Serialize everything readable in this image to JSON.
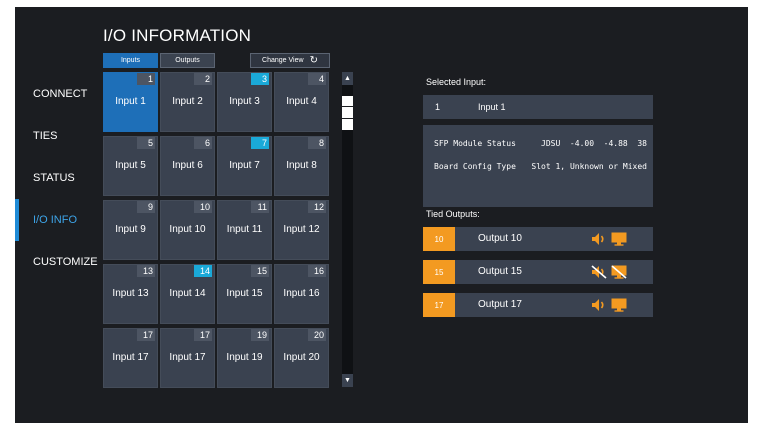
{
  "page": {
    "title": "I/O INFORMATION"
  },
  "tabs": {
    "inputs": "Inputs",
    "outputs": "Outputs",
    "change_view": "Change View"
  },
  "nav": [
    "CONNECT",
    "TIES",
    "STATUS",
    "I/O INFO",
    "CUSTOMIZE"
  ],
  "nav_active": "I/O INFO",
  "inputs": [
    {
      "num": "1",
      "label": "Input 1",
      "selected": true
    },
    {
      "num": "2",
      "label": "Input 2"
    },
    {
      "num": "3",
      "label": "Input 3",
      "highlight": true
    },
    {
      "num": "4",
      "label": "Input 4"
    },
    {
      "num": "5",
      "label": "Input 5"
    },
    {
      "num": "6",
      "label": "Input 6"
    },
    {
      "num": "7",
      "label": "Input 7",
      "highlight": true
    },
    {
      "num": "8",
      "label": "Input 8"
    },
    {
      "num": "9",
      "label": "Input 9"
    },
    {
      "num": "10",
      "label": "Input 10"
    },
    {
      "num": "11",
      "label": "Input 11"
    },
    {
      "num": "12",
      "label": "Input 12"
    },
    {
      "num": "13",
      "label": "Input 13"
    },
    {
      "num": "14",
      "label": "Input 14",
      "highlight": true
    },
    {
      "num": "15",
      "label": "Input 15"
    },
    {
      "num": "16",
      "label": "Input 16"
    },
    {
      "num": "17",
      "label": "Input 17"
    },
    {
      "num": "17",
      "label": "Input 17"
    },
    {
      "num": "19",
      "label": "Input 19"
    },
    {
      "num": "20",
      "label": "Input 20"
    }
  ],
  "selected_input": {
    "heading": "Selected Input:",
    "num": "1",
    "name": "Input 1"
  },
  "info": [
    {
      "key": "SFP Module Status",
      "value": "JDSU  -4.00  -4.88  38"
    },
    {
      "key": "Board Config Type",
      "value": "Slot 1, Unknown or Mixed"
    }
  ],
  "tied_outputs": {
    "heading": "Tied Outputs:",
    "items": [
      {
        "num": "10",
        "name": "Output 10",
        "muted": false
      },
      {
        "num": "15",
        "name": "Output 15",
        "muted": true
      },
      {
        "num": "17",
        "name": "Output 17",
        "muted": false
      }
    ]
  },
  "colors": {
    "accent_blue": "#1e6fb8",
    "highlight_cyan": "#1aa9d8",
    "output_orange": "#f39a21",
    "tile": "#3a4250",
    "background": "#1b1d21"
  }
}
